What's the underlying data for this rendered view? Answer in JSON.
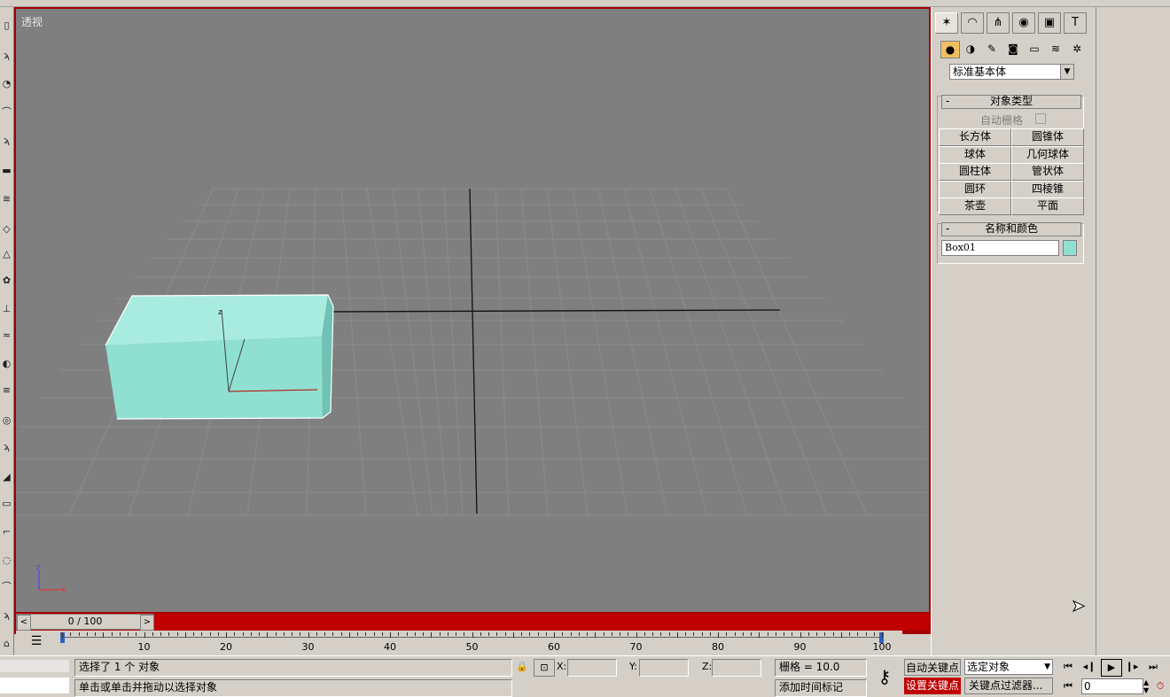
{
  "viewport": {
    "label": "透视",
    "nav_axis": {
      "x": "x",
      "z": "z"
    },
    "gizmo_label": "z"
  },
  "time_slider": {
    "left_arrow": "<",
    "right_arrow": ">",
    "value": "0 / 100"
  },
  "trackbar": {
    "labels": [
      "10",
      "20",
      "30",
      "40",
      "50",
      "60",
      "70",
      "80",
      "90",
      "100"
    ]
  },
  "command_panel": {
    "tabs": [
      "create-icon",
      "modify-icon",
      "hierarchy-icon",
      "motion-icon",
      "display-icon",
      "utilities-icon"
    ],
    "subcategories": [
      "geometry-icon",
      "shapes-icon",
      "lights-icon",
      "cameras-icon",
      "helpers-icon",
      "spacewarps-icon",
      "systems-icon"
    ],
    "category_dropdown": "标准基本体",
    "object_type": {
      "title": "对象类型",
      "collapse": "-",
      "autogrid_label": "自动栅格",
      "buttons": [
        "长方体",
        "圆锥体",
        "球体",
        "几何球体",
        "圆柱体",
        "管状体",
        "圆环",
        "四棱锥",
        "茶壶",
        "平面"
      ]
    },
    "name_color": {
      "title": "名称和颜色",
      "collapse": "-",
      "name_value": "Box01",
      "color": "#8fe0d0"
    }
  },
  "status": {
    "selection": "选择了 1 个 对象",
    "prompt": "单击或单击并拖动以选择对象",
    "x_label": "X:",
    "y_label": "Y:",
    "z_label": "Z:",
    "grid": "栅格 = 10.0",
    "add_time_tag": "添加时间标记",
    "auto_key": "自动关键点",
    "set_key": "设置关键点",
    "selection_set": "选定对象",
    "key_filters": "关键点过滤器...",
    "frame_value": "0"
  },
  "colors": {
    "viewport_bg": "#7f7f7f",
    "box": "#8fe0d0",
    "active_border": "#c00000",
    "set_key_bg": "#c00000"
  }
}
